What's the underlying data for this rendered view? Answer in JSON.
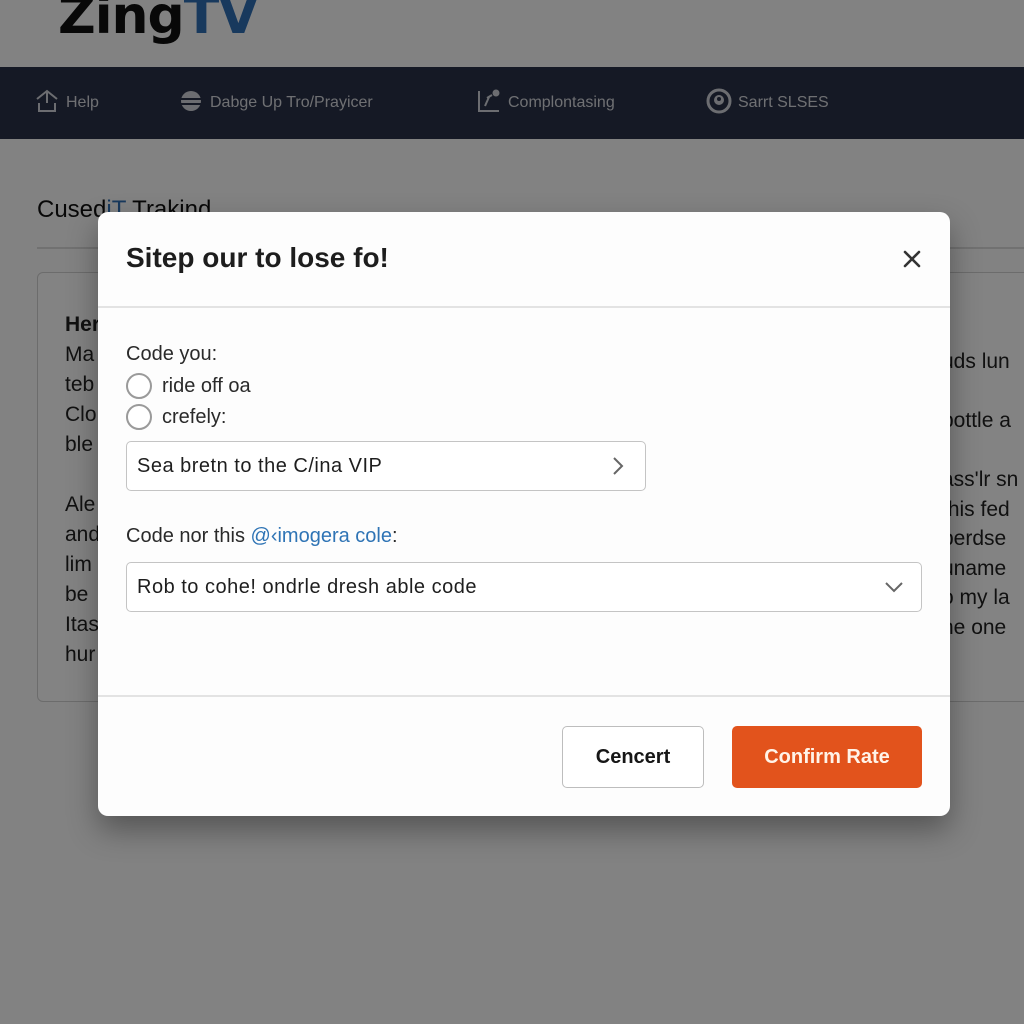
{
  "app": {
    "logo_part1": "Zing",
    "logo_part2": "TV"
  },
  "navbar": {
    "items": [
      {
        "label": "Help",
        "icon": "upload-tray-icon"
      },
      {
        "label": "Dabge Up Tro/Prayicer",
        "icon": "stack-disc-icon"
      },
      {
        "label": "Complontasing",
        "icon": "chart-edit-icon"
      },
      {
        "label": "Sarrt SLSES",
        "icon": "user-circle-icon"
      }
    ]
  },
  "background": {
    "section_title_a": "Cused",
    "section_title_b": "iT",
    "section_title_c": " Trakind",
    "card_heading": "Her",
    "card_left_lines": [
      "Ma",
      "teb",
      "Clo",
      "ble",
      "",
      "Ale",
      "and",
      "lim",
      "be",
      "Itas",
      "hur"
    ],
    "card_right_lines": [
      "uds lun",
      "",
      "pottle a",
      "",
      "ass'lr sn",
      "this fed",
      "berdse",
      "uname",
      "o my la",
      "he one"
    ]
  },
  "modal": {
    "title": "Sitep our to lose fo!",
    "close_label": "×",
    "radio_group_label": "Code you:",
    "radio_options": [
      {
        "label": "ride off oa",
        "selected": false
      },
      {
        "label": "crefely:",
        "selected": false
      }
    ],
    "link_field": {
      "value": "Sea bretn to the C/ina VIP"
    },
    "select_label_prefix": "Code nor this ",
    "select_label_link": "@‹imogera cole",
    "select_label_suffix": ":",
    "select_field": {
      "selected": "Rob to cohe!  ondrle dresh able code"
    },
    "buttons": {
      "cancel": "Cencert",
      "confirm": "Confirm Rate"
    }
  },
  "colors": {
    "accent": "#e2531c",
    "link": "#2f74b5",
    "navbar_bg": "#2a3147",
    "logo_blue": "#2f6db3"
  }
}
